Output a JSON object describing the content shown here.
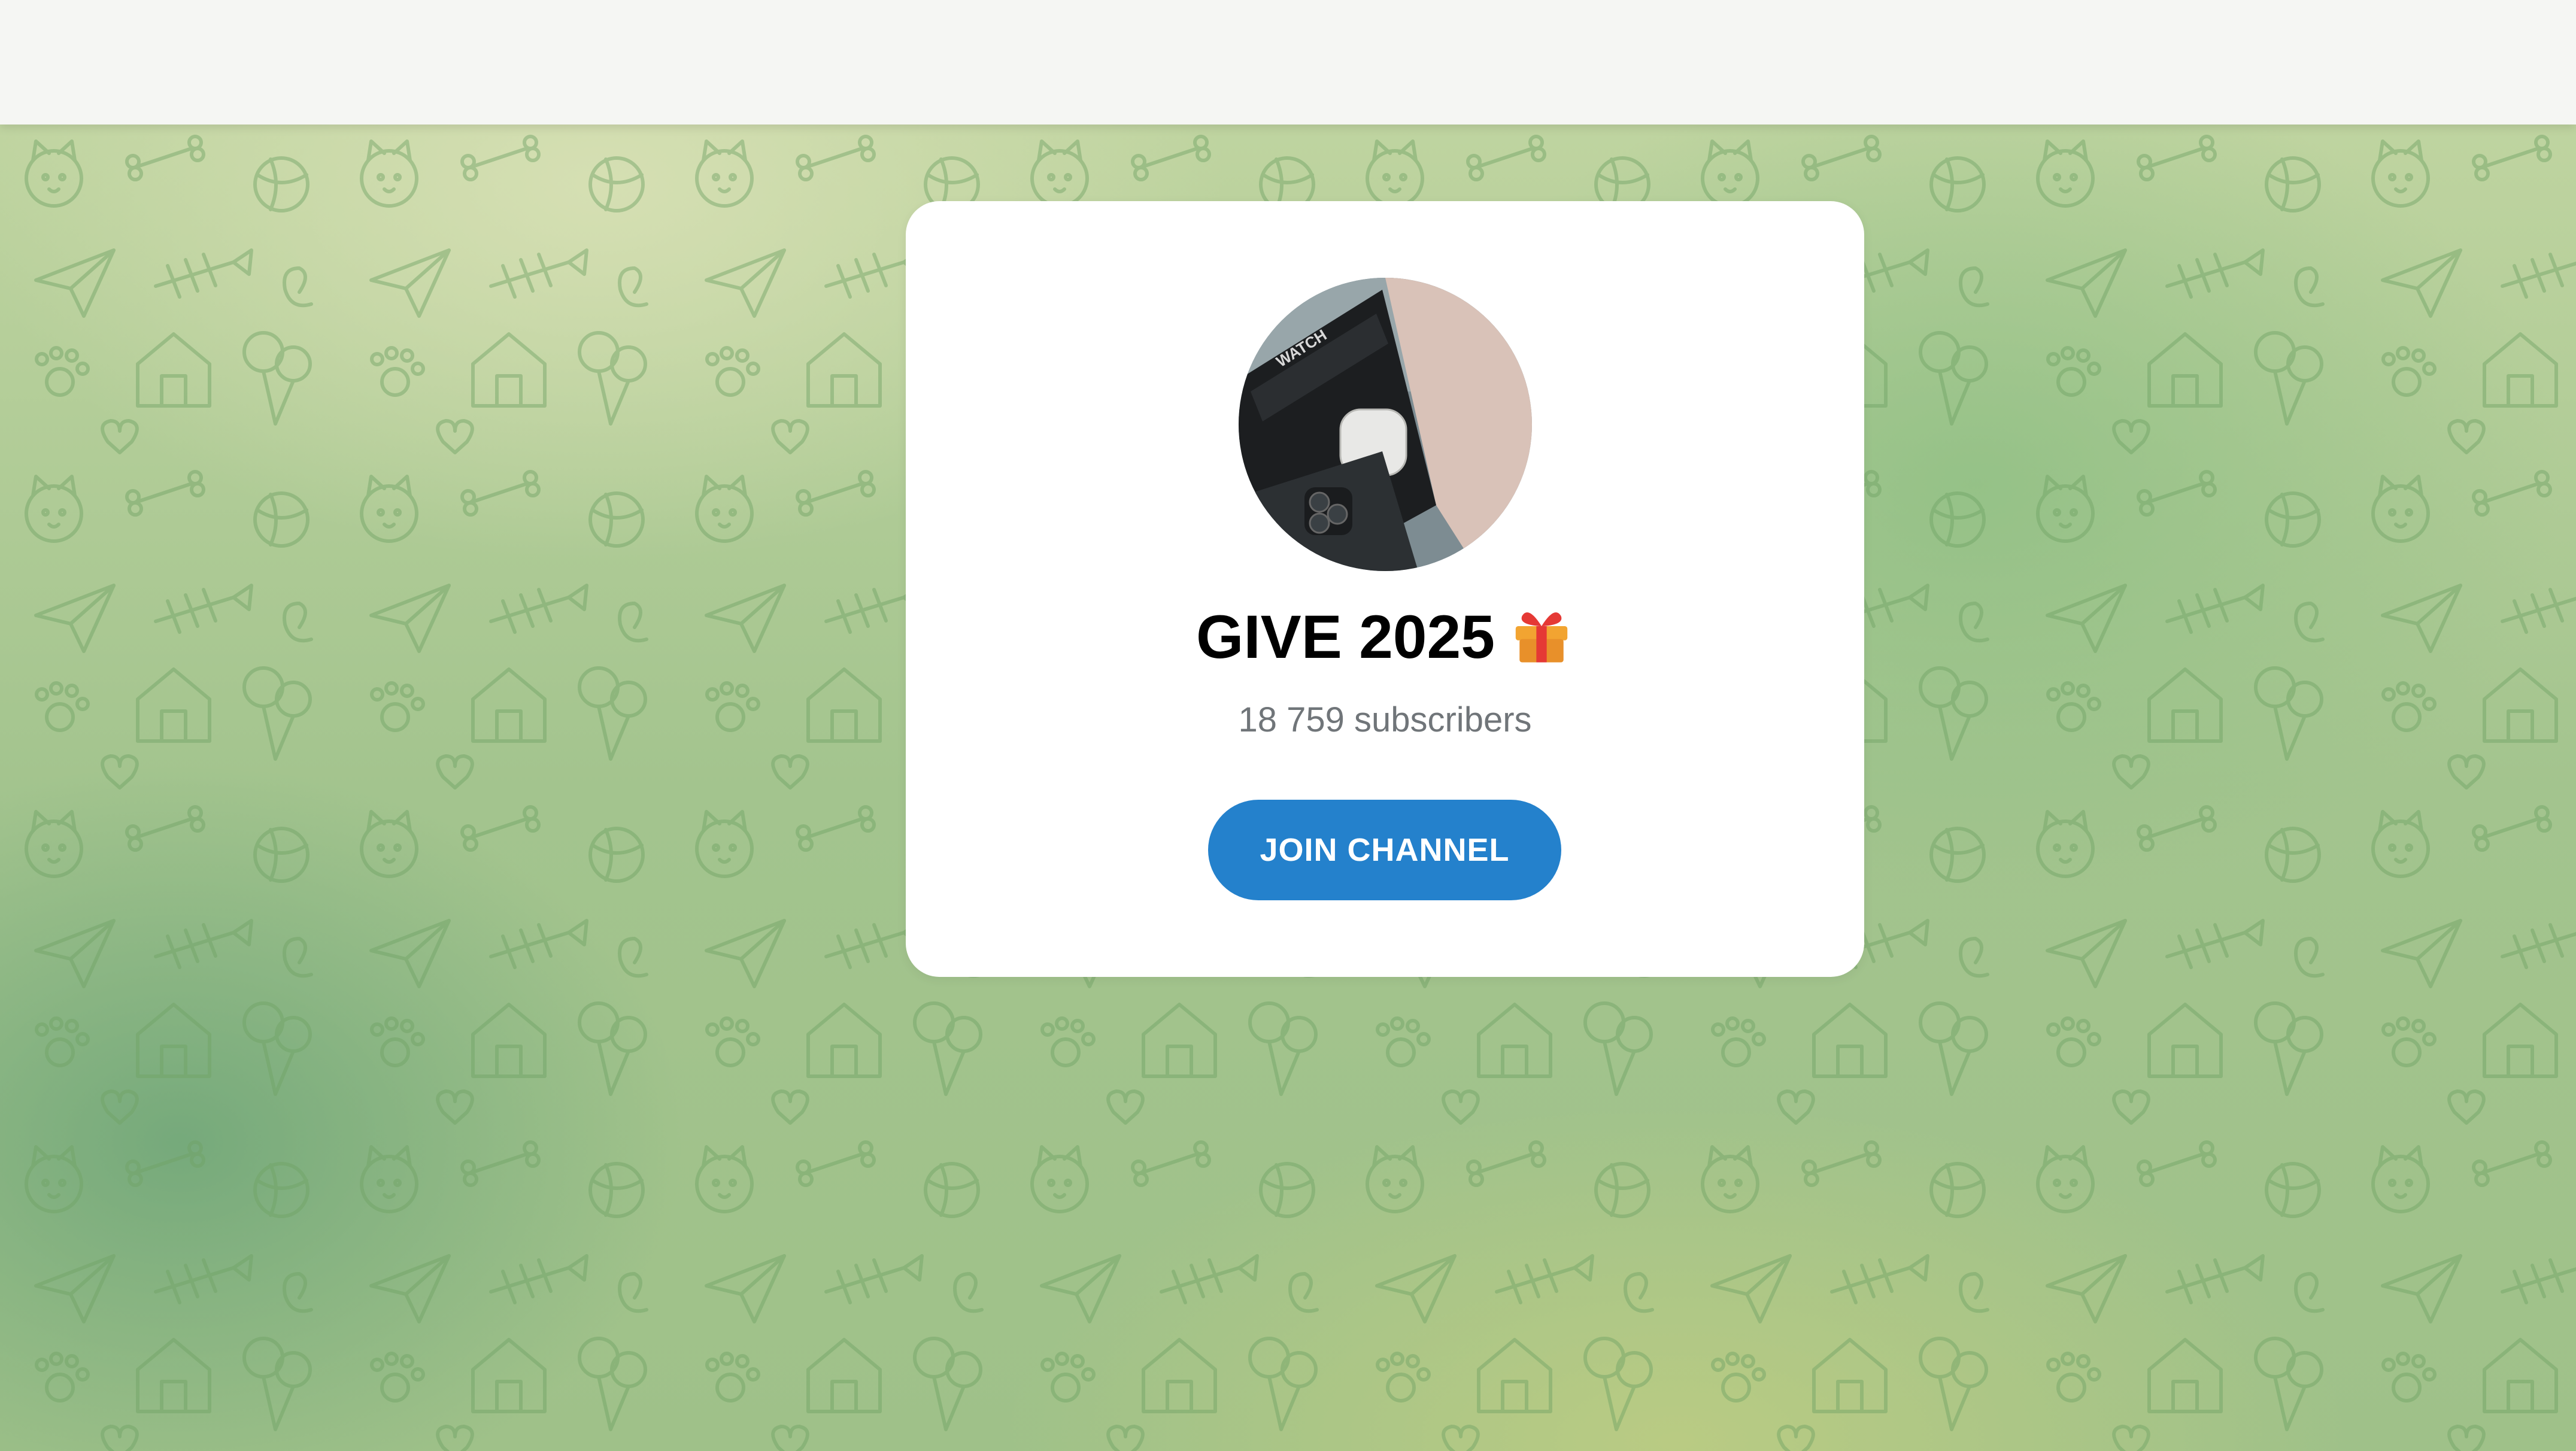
{
  "channel": {
    "name": "GIVE 2025",
    "emoji_icon": "gift-icon",
    "subscribers_text": "18 759 subscribers",
    "avatar_description_icon": "avatar-image"
  },
  "join_button": {
    "label": "JOIN CHANNEL",
    "color": "#2481cc"
  },
  "colors": {
    "top_bar": "#f5f6f3",
    "background": "#a3c48e",
    "pattern_stroke": "#7fae6f"
  }
}
